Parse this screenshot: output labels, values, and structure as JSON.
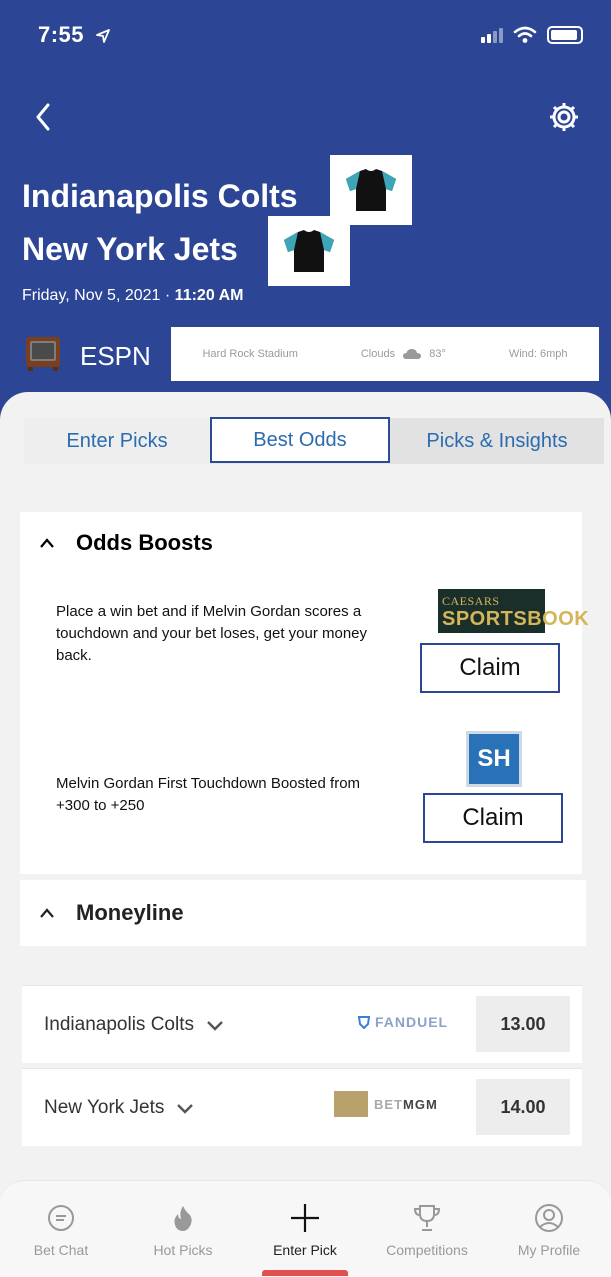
{
  "status_bar": {
    "time": "7:55"
  },
  "game": {
    "team_home": "Indianapolis Colts",
    "team_away": "New York Jets",
    "date": "Friday, Nov 5, 2021",
    "separator": "·",
    "time": "11:20 AM",
    "network": "ESPN",
    "stadium": "Hard Rock Stadium",
    "weather": "Clouds",
    "temperature": "83°",
    "wind": "Wind: 6mph"
  },
  "tabs": [
    {
      "label": "Enter Picks"
    },
    {
      "label": "Best Odds"
    },
    {
      "label": "Picks & Insights"
    }
  ],
  "odds_boosts": {
    "title": "Odds Boosts",
    "offers": [
      {
        "text": "Place a win bet and if Melvin Gordan scores a touchdown and your bet loses, get your money back.",
        "book_line1": "CAESARS",
        "book_line2": "SPORTSBOOK",
        "claim_label": "Claim"
      },
      {
        "text": "Melvin Gordan First Touchdown Boosted from +300 to +250",
        "book_logo": "SH",
        "claim_label": "Claim"
      }
    ]
  },
  "moneyline": {
    "title": "Moneyline",
    "rows": [
      {
        "team": "Indianapolis Colts",
        "book": "FANDUEL",
        "odds": "13.00"
      },
      {
        "team": "New York Jets",
        "book_prefix": "BET",
        "book_suffix": "MGM",
        "odds": "14.00"
      }
    ]
  },
  "bottom_nav": [
    {
      "label": "Bet Chat",
      "icon": "chat-bubble-icon"
    },
    {
      "label": "Hot Picks",
      "icon": "flame-icon"
    },
    {
      "label": "Enter Pick",
      "icon": "plus-icon"
    },
    {
      "label": "Competitions",
      "icon": "trophy-icon"
    },
    {
      "label": "My Profile",
      "icon": "profile-icon"
    }
  ],
  "colors": {
    "header_bg": "#2c4695",
    "tab_text": "#2b6cb0",
    "active_indicator": "#e24f4f"
  }
}
